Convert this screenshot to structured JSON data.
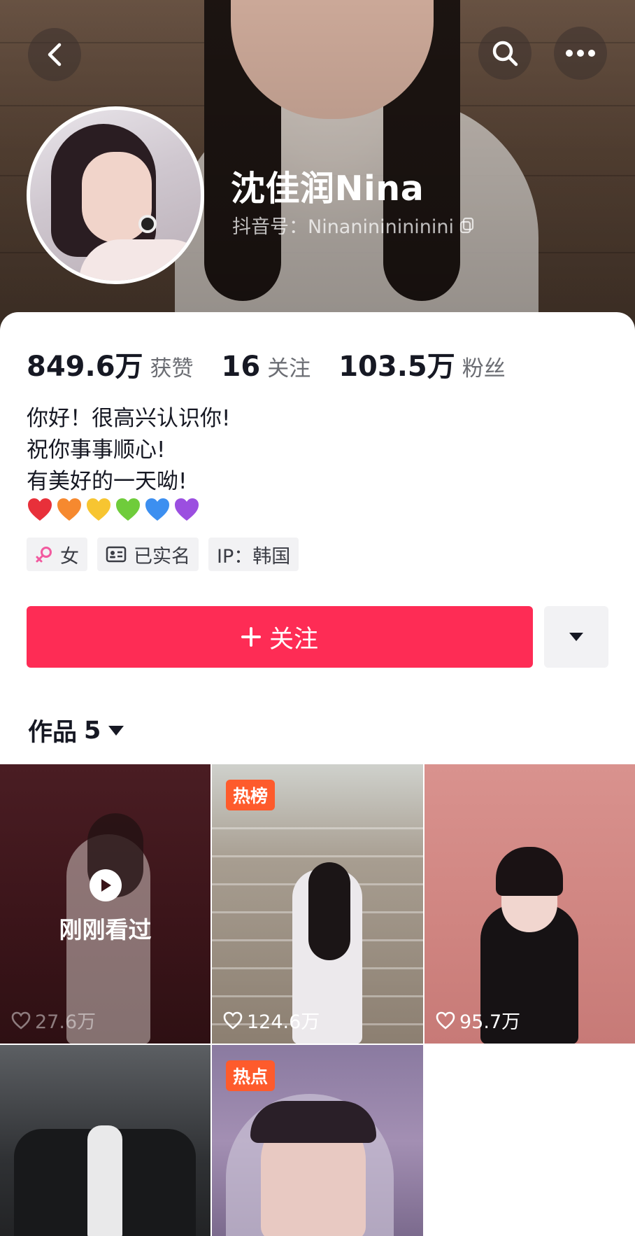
{
  "profile": {
    "name": "沈佳润Nina",
    "handle": "抖音号：Ninanininininini",
    "stats": [
      {
        "value": "849.6万",
        "label": "获赞"
      },
      {
        "value": "16",
        "label": "关注"
      },
      {
        "value": "103.5万",
        "label": "粉丝"
      }
    ],
    "bio": [
      "你好！很高兴认识你!",
      "祝你事事顺心!",
      "有美好的一天呦!"
    ],
    "emoji_hearts": [
      "#e8303a",
      "#f6892f",
      "#f7c531",
      "#6fcc3b",
      "#3c8ff0",
      "#9b4fe0"
    ],
    "tags": [
      {
        "icon": "female-icon",
        "label": "女"
      },
      {
        "icon": "id-card-icon",
        "label": "已实名"
      },
      {
        "icon": "",
        "label": "IP：韩国"
      }
    ]
  },
  "actions": {
    "follow_label": "关注",
    "follow_color": "#fe2c55"
  },
  "works": {
    "label": "作品",
    "count": "5",
    "items": [
      {
        "likes": "27.6万",
        "badge": "",
        "overlay": "刚刚看过"
      },
      {
        "likes": "124.6万",
        "badge": "热榜",
        "overlay": ""
      },
      {
        "likes": "95.7万",
        "badge": "",
        "overlay": ""
      },
      {
        "likes": "",
        "badge": "",
        "overlay": ""
      },
      {
        "likes": "",
        "badge": "热点",
        "overlay": ""
      }
    ]
  }
}
